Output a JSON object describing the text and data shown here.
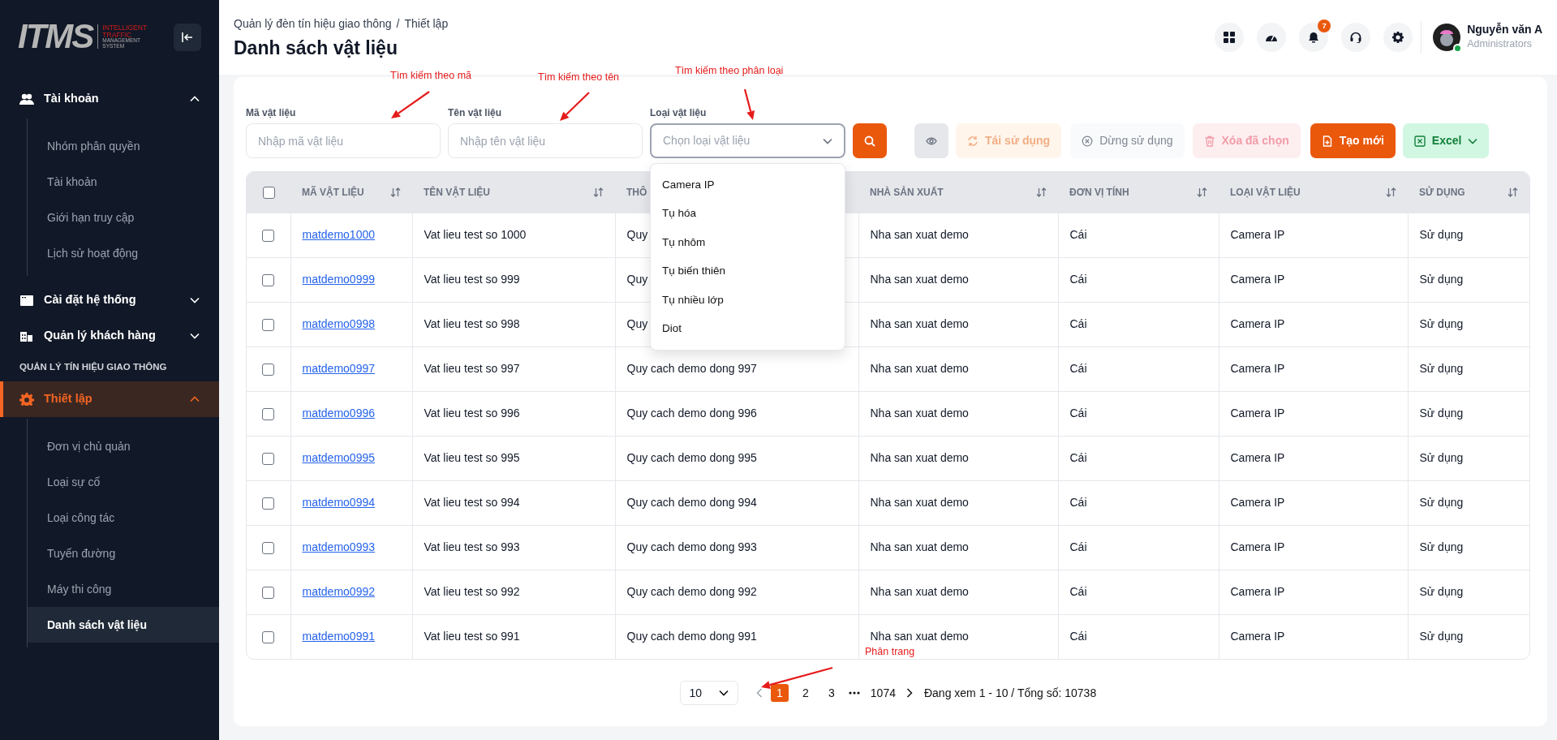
{
  "sidebar": {
    "logo": {
      "mark": "ITMS",
      "tagline_red": [
        "INTELLIGENT",
        "TRAFFIC"
      ],
      "tagline_gray": [
        "MANAGEMENT",
        "SYSTEM"
      ]
    },
    "menu": [
      {
        "kind": "group",
        "label": "Tài khoản",
        "expanded": true,
        "selected": false,
        "children": [
          {
            "label": "Nhóm phân quyền",
            "selected": false
          },
          {
            "label": "Tài khoản",
            "selected": false
          },
          {
            "label": "Giới hạn truy cập",
            "selected": false
          },
          {
            "label": "Lịch sử hoạt động",
            "selected": false
          }
        ]
      },
      {
        "kind": "group",
        "label": "Cài đặt hệ thống",
        "expanded": false,
        "selected": false
      },
      {
        "kind": "group",
        "label": "Quản lý khách hàng",
        "expanded": false,
        "selected": false
      },
      {
        "kind": "section",
        "label": "QUẢN LÝ TÍN HIỆU GIAO THÔNG"
      },
      {
        "kind": "group",
        "label": "Thiết lập",
        "expanded": true,
        "selected": true,
        "children": [
          {
            "label": "Đơn vị chủ quản",
            "selected": false
          },
          {
            "label": "Loại sự cố",
            "selected": false
          },
          {
            "label": "Loại công tác",
            "selected": false
          },
          {
            "label": "Tuyến đường",
            "selected": false
          },
          {
            "label": "Máy thi công",
            "selected": false
          },
          {
            "label": "Danh sách vật liệu",
            "selected": true
          }
        ]
      }
    ]
  },
  "header": {
    "breadcrumb": [
      "Quản lý đèn tín hiệu giao thông",
      "Thiết lập"
    ],
    "separator": "/",
    "title": "Danh sách vật liệu",
    "notification_count": "7",
    "user": {
      "name": "Nguyễn văn A",
      "role": "Administrators",
      "online": true
    }
  },
  "filters": {
    "fields": [
      {
        "kind": "input",
        "label": "Mã vật liệu",
        "placeholder": "Nhập mã vật liệu"
      },
      {
        "kind": "input",
        "label": "Tên vật liệu",
        "placeholder": "Nhập tên vật liệu"
      },
      {
        "kind": "select",
        "label": "Loại vật liệu",
        "placeholder": "Chọn loại vật liệu",
        "open": true,
        "options": [
          "Camera IP",
          "Tụ hóa",
          "Tụ nhôm",
          "Tụ biến thiên",
          "Tụ nhiều lớp",
          "Diot"
        ]
      }
    ]
  },
  "buttons": [
    {
      "kind": "search",
      "disabled": false
    },
    {
      "kind": "view",
      "disabled": false
    },
    {
      "kind": "reuse",
      "label": "Tái sử dụng",
      "disabled": true
    },
    {
      "kind": "stop",
      "label": "Dừng sử dụng",
      "disabled": true
    },
    {
      "kind": "delete",
      "label": "Xóa đã chọn",
      "disabled": true
    },
    {
      "kind": "create",
      "label": "Tạo mới",
      "disabled": false
    },
    {
      "kind": "export",
      "label": "Excel",
      "disabled": false
    }
  ],
  "table": {
    "all_checked": false,
    "columns": [
      {
        "label": "MÃ VẬT LIỆU",
        "sortable": true
      },
      {
        "label": "TÊN VẬT LIỆU",
        "sortable": true
      },
      {
        "label": "THÔ",
        "sortable": false
      },
      {
        "label": "NHÀ SẢN XUẤT",
        "sortable": true
      },
      {
        "label": "ĐƠN VỊ TÍNH",
        "sortable": true
      },
      {
        "label": "LOẠI VẬT LIỆU",
        "sortable": true
      },
      {
        "label": "SỬ DỤNG",
        "sortable": true
      }
    ],
    "rows": [
      {
        "checked": false,
        "cells": [
          "matdemo1000",
          "Vat lieu test so 1000",
          "Quy",
          "Nha san xuat demo",
          "Cái",
          "Camera IP",
          "Sử dụng"
        ]
      },
      {
        "checked": false,
        "cells": [
          "matdemo0999",
          "Vat lieu test so 999",
          "Quy",
          "Nha san xuat demo",
          "Cái",
          "Camera IP",
          "Sử dụng"
        ]
      },
      {
        "checked": false,
        "cells": [
          "matdemo0998",
          "Vat lieu test so 998",
          "Quy",
          "Nha san xuat demo",
          "Cái",
          "Camera IP",
          "Sử dụng"
        ]
      },
      {
        "checked": false,
        "cells": [
          "matdemo0997",
          "Vat lieu test so 997",
          "Quy cach demo dong 997",
          "Nha san xuat demo",
          "Cái",
          "Camera IP",
          "Sử dụng"
        ]
      },
      {
        "checked": false,
        "cells": [
          "matdemo0996",
          "Vat lieu test so 996",
          "Quy cach demo dong 996",
          "Nha san xuat demo",
          "Cái",
          "Camera IP",
          "Sử dụng"
        ]
      },
      {
        "checked": false,
        "cells": [
          "matdemo0995",
          "Vat lieu test so 995",
          "Quy cach demo dong 995",
          "Nha san xuat demo",
          "Cái",
          "Camera IP",
          "Sử dụng"
        ]
      },
      {
        "checked": false,
        "cells": [
          "matdemo0994",
          "Vat lieu test so 994",
          "Quy cach demo dong 994",
          "Nha san xuat demo",
          "Cái",
          "Camera IP",
          "Sử dụng"
        ]
      },
      {
        "checked": false,
        "cells": [
          "matdemo0993",
          "Vat lieu test so 993",
          "Quy cach demo dong 993",
          "Nha san xuat demo",
          "Cái",
          "Camera IP",
          "Sử dụng"
        ]
      },
      {
        "checked": false,
        "cells": [
          "matdemo0992",
          "Vat lieu test so 992",
          "Quy cach demo dong 992",
          "Nha san xuat demo",
          "Cái",
          "Camera IP",
          "Sử dụng"
        ]
      },
      {
        "checked": false,
        "cells": [
          "matdemo0991",
          "Vat lieu test so 991",
          "Quy cach demo dong 991",
          "Nha san xuat demo",
          "Cái",
          "Camera IP",
          "Sử dụng"
        ]
      }
    ]
  },
  "pagination": {
    "page_size": "10",
    "pages": [
      {
        "label": "1",
        "selected": true
      },
      {
        "label": "2",
        "selected": false
      },
      {
        "label": "3",
        "selected": false
      }
    ],
    "last_page": "1074",
    "summary": "Đang xem 1 - 10 / Tổng số: 10738"
  },
  "annotations": [
    {
      "text": "Tìm kiếm theo mã"
    },
    {
      "text": "Tìm kiếm theo tên"
    },
    {
      "text": "Tìm kiếm theo phân loại"
    },
    {
      "text": "Phân trang"
    }
  ]
}
